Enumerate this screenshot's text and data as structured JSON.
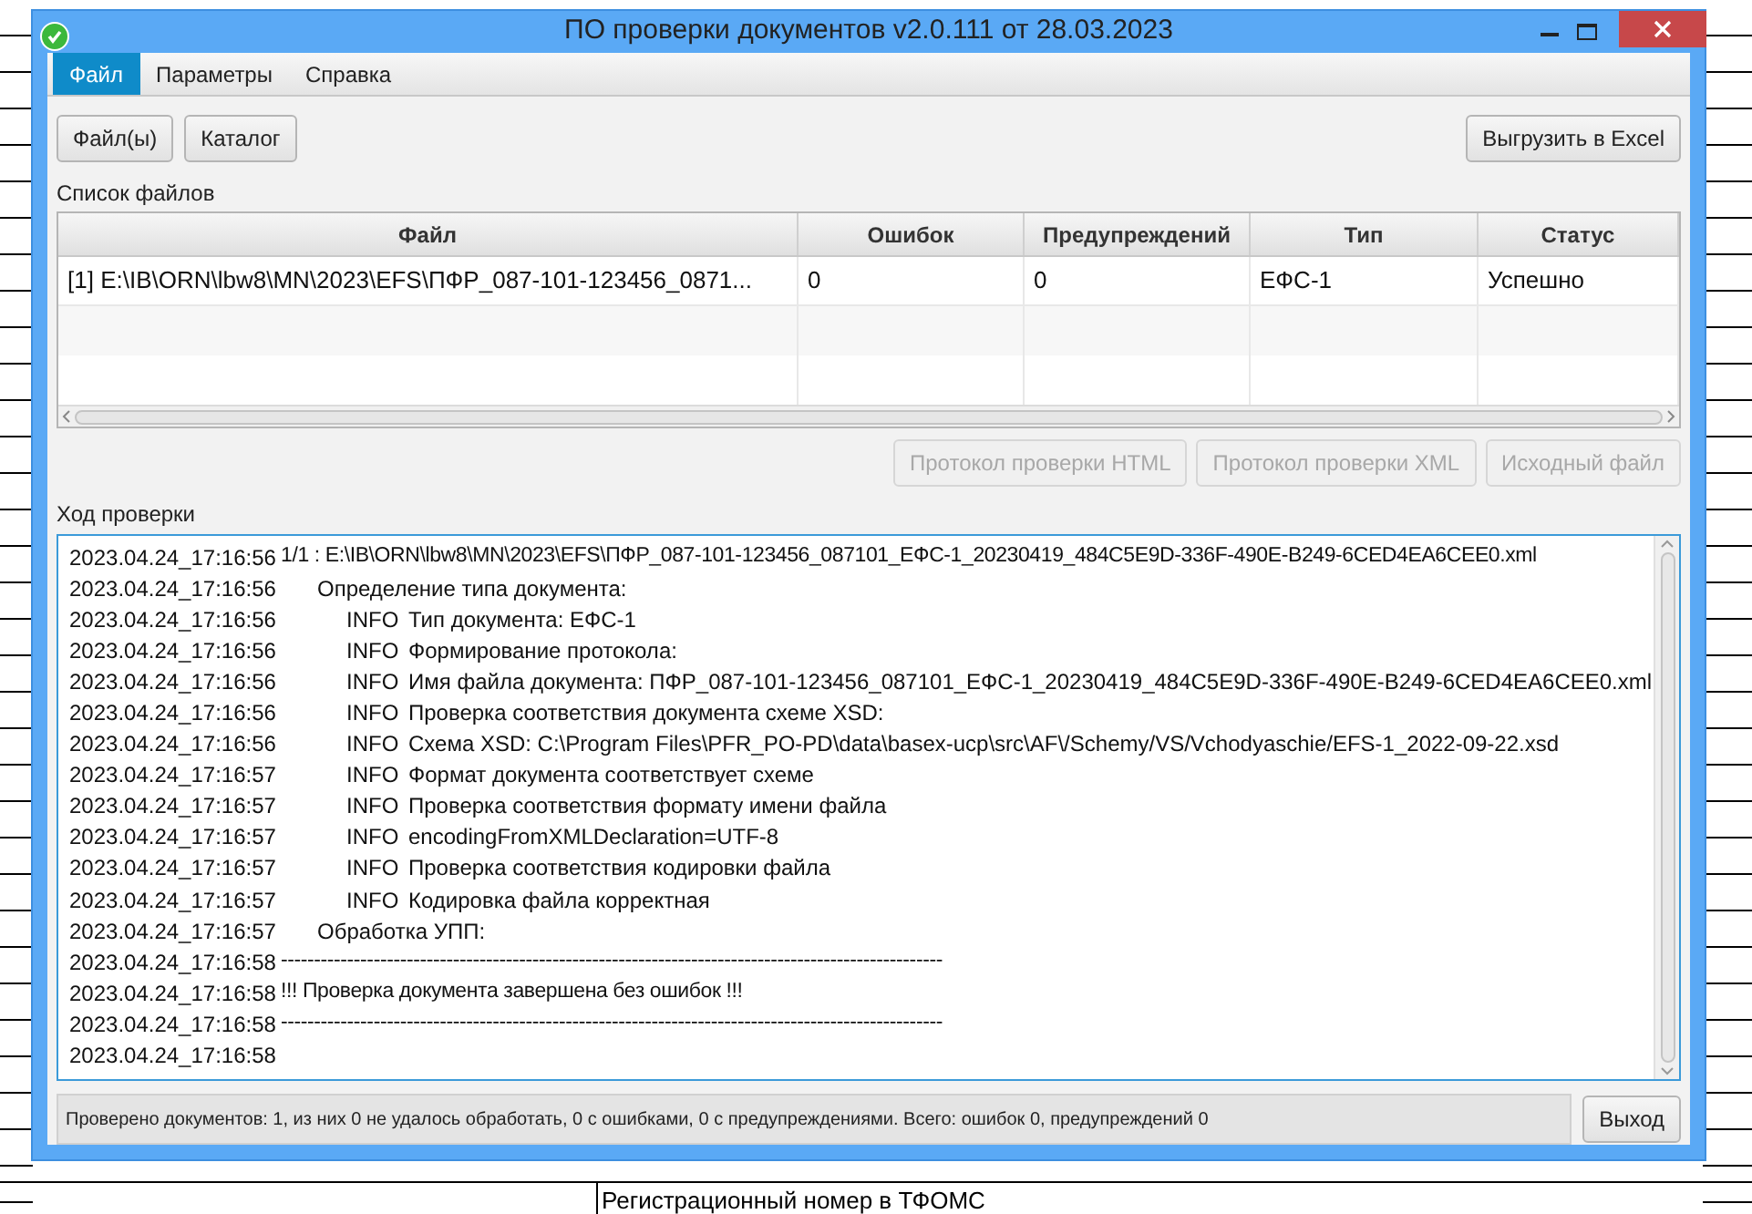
{
  "background_document": {
    "bottom_text": "Регистрационный номер в ТФОМС"
  },
  "window": {
    "title": "ПО проверки документов v2.0.111 от 28.03.2023"
  },
  "menu": [
    {
      "label": "Файл",
      "selected": true
    },
    {
      "label": "Параметры",
      "selected": false
    },
    {
      "label": "Справка",
      "selected": false
    }
  ],
  "toolbar": {
    "left_buttons": [
      "Файл(ы)",
      "Каталог"
    ],
    "right_button": "Выгрузить в Excel"
  },
  "files_section": {
    "title": "Список файлов",
    "columns": [
      "Файл",
      "Ошибок",
      "Предупреждений",
      "Тип",
      "Статус"
    ],
    "rows": [
      [
        "[1] E:\\IB\\ORN\\lbw8\\MN\\2023\\EFS\\ПФР_087-101-123456_0871...",
        "0",
        "0",
        "ЕФС-1",
        "Успешно"
      ]
    ]
  },
  "action_buttons": [
    {
      "label": "Протокол проверки HTML",
      "disabled": true
    },
    {
      "label": "Протокол проверки XML",
      "disabled": true
    },
    {
      "label": "Исходный файл",
      "disabled": true
    }
  ],
  "log_section": {
    "title": "Ход проверки",
    "lines": [
      {
        "time": "2023.04.24_17:16:56",
        "kind": "header",
        "text": "1/1  : E:\\IB\\ORN\\lbw8\\MN\\2023\\EFS\\ПФР_087-101-123456_087101_ЕФС-1_20230419_484C5E9D-336F-490E-B249-6CED4EA6CEE0.xml"
      },
      {
        "time": "2023.04.24_17:16:56",
        "kind": "step",
        "text": "Определение типа документа:"
      },
      {
        "time": "2023.04.24_17:16:56",
        "kind": "info",
        "tag": "INFO",
        "text": "Тип документа: ЕФС-1"
      },
      {
        "time": "2023.04.24_17:16:56",
        "kind": "info",
        "tag": "INFO",
        "text": "Формирование протокола:"
      },
      {
        "time": "2023.04.24_17:16:56",
        "kind": "info",
        "tag": "INFO",
        "text": "Имя файла документа: ПФР_087-101-123456_087101_ЕФС-1_20230419_484C5E9D-336F-490E-B249-6CED4EA6CEE0.xml"
      },
      {
        "time": "2023.04.24_17:16:56",
        "kind": "info",
        "tag": "INFO",
        "text": "Проверка соответствия документа схеме XSD:"
      },
      {
        "time": "2023.04.24_17:16:56",
        "kind": "info",
        "tag": "INFO",
        "text": "Схема XSD: C:\\Program Files\\PFR_PO-PD\\data\\basex-ucp\\src\\AF\\/Schemy/VS/Vchodyaschie/EFS-1_2022-09-22.xsd"
      },
      {
        "time": "2023.04.24_17:16:57",
        "kind": "info",
        "tag": "INFO",
        "text": "Формат документа соответствует схеме"
      },
      {
        "time": "2023.04.24_17:16:57",
        "kind": "info",
        "tag": "INFO",
        "text": "Проверка соответствия формату имени файла"
      },
      {
        "time": "2023.04.24_17:16:57",
        "kind": "info",
        "tag": "INFO",
        "text": "encodingFromXMLDeclaration=UTF-8"
      },
      {
        "time": "2023.04.24_17:16:57",
        "kind": "info",
        "tag": "INFO",
        "text": "Проверка соответствия кодировки файла"
      },
      {
        "time": "2023.04.24_17:16:57",
        "kind": "info",
        "tag": "INFO",
        "text": "Кодировка файла корректная"
      },
      {
        "time": "2023.04.24_17:16:57",
        "kind": "step",
        "text": "Обработка УПП:"
      },
      {
        "time": "2023.04.24_17:16:58",
        "kind": "header",
        "text": "----------------------------------------------------------------------------------------------------"
      },
      {
        "time": "2023.04.24_17:16:58",
        "kind": "header",
        "text": "!!!  Проверка документа завершена без ошибок  !!!"
      },
      {
        "time": "2023.04.24_17:16:58",
        "kind": "header",
        "text": "----------------------------------------------------------------------------------------------------"
      },
      {
        "time": "2023.04.24_17:16:58",
        "kind": "time_only"
      }
    ]
  },
  "status_bar": {
    "text": "Проверено документов: 1, из них 0 не удалось обработать, 0 с ошибками, 0 с предупреждениями. Всего: ошибок 0, предупреждений 0",
    "exit_button": "Выход"
  }
}
